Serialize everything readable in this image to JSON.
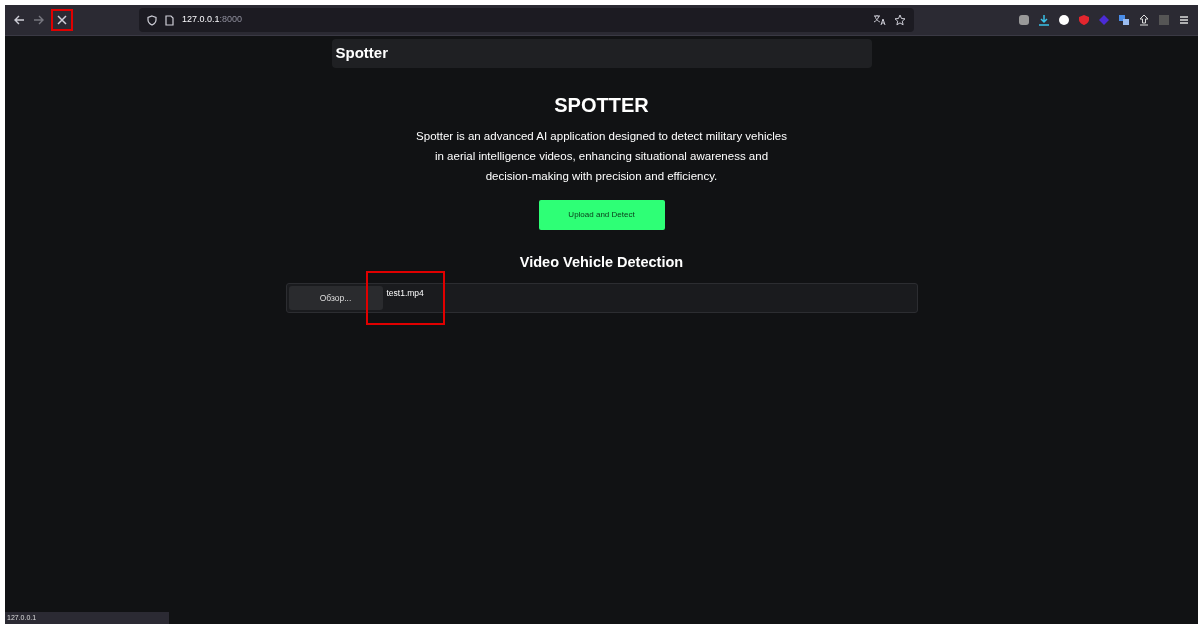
{
  "browser": {
    "stop_highlighted": true,
    "url_host": "127.0.0.1",
    "url_port": ":8000"
  },
  "navbar": {
    "brand": "Spotter"
  },
  "hero": {
    "title": "SPOTTER",
    "description": "Spotter is an advanced AI application designed to detect military vehicles in aerial intelligence videos, enhancing situational awareness and decision-making with precision and efficiency.",
    "button": "Upload and Detect"
  },
  "detection": {
    "heading": "Video Vehicle Detection",
    "browse_button": "Обзор...",
    "file_name": "test1.mp4",
    "file_highlighted": true
  },
  "status_bar": "127.0.0.1"
}
